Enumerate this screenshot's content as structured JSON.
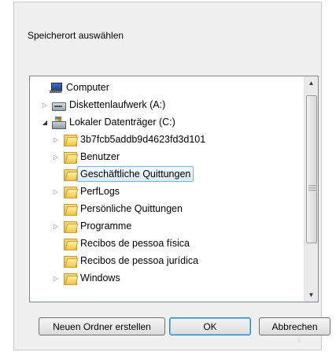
{
  "dialog": {
    "instruction": "Speicherort auswählen"
  },
  "tree": {
    "items": [
      {
        "label": "Computer",
        "icon": "computer-icon",
        "arrow": "none",
        "level": 0
      },
      {
        "label": "Diskettenlaufwerk (A:)",
        "icon": "floppy-drive-icon",
        "arrow": "collapsed",
        "level": 1
      },
      {
        "label": "Lokaler Datenträger (C:)",
        "icon": "hard-drive-icon",
        "arrow": "expanded",
        "level": 1
      },
      {
        "label": "3b7fcb5addb9d4623fd3d101",
        "icon": "folder-icon",
        "arrow": "collapsed",
        "level": 2
      },
      {
        "label": "Benutzer",
        "icon": "folder-icon",
        "arrow": "collapsed",
        "level": 2
      },
      {
        "label": "Geschäftliche Quittungen",
        "icon": "folder-icon",
        "arrow": "none",
        "level": 2,
        "selected": true
      },
      {
        "label": "PerfLogs",
        "icon": "folder-icon",
        "arrow": "collapsed",
        "level": 2
      },
      {
        "label": "Persönliche Quittungen",
        "icon": "folder-icon",
        "arrow": "none",
        "level": 2
      },
      {
        "label": "Programme",
        "icon": "folder-icon",
        "arrow": "collapsed",
        "level": 2
      },
      {
        "label": "Recibos de pessoa física",
        "icon": "folder-icon",
        "arrow": "none",
        "level": 2
      },
      {
        "label": "Recibos de pessoa jurídica",
        "icon": "folder-icon",
        "arrow": "none",
        "level": 2
      },
      {
        "label": "Windows",
        "icon": "folder-icon",
        "arrow": "collapsed",
        "level": 2
      }
    ]
  },
  "buttons": {
    "new_folder": "Neuen Ordner erstellen",
    "ok": "OK",
    "cancel": "Abbrechen"
  },
  "colors": {
    "selection_border": "#7db2e8",
    "selection_fill": "#dcecfc",
    "default_button_border": "#3c7fb1"
  }
}
